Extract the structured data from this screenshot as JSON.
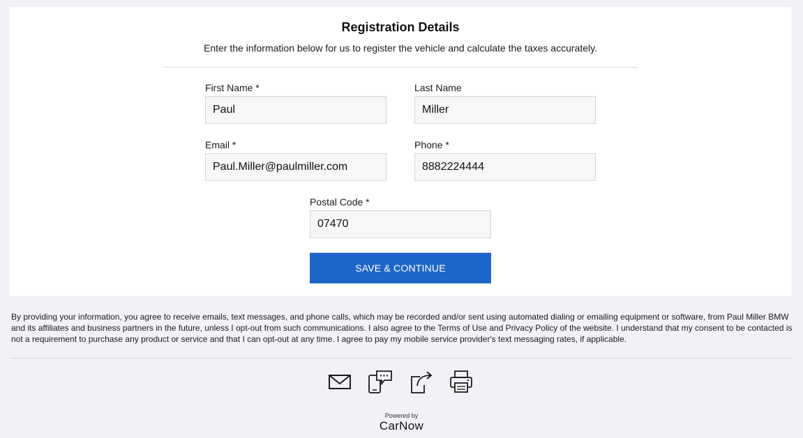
{
  "form": {
    "title": "Registration Details",
    "subtitle": "Enter the information below for us to register the vehicle and calculate the taxes accurately.",
    "first_name": {
      "label": "First Name *",
      "value": "Paul"
    },
    "last_name": {
      "label": "Last Name",
      "value": "Miller"
    },
    "email": {
      "label": "Email *",
      "value": "Paul.Miller@paulmiller.com"
    },
    "phone": {
      "label": "Phone *",
      "value": "8882224444"
    },
    "postal_code": {
      "label": "Postal Code *",
      "value": "07470"
    },
    "save_label": "SAVE & CONTINUE"
  },
  "disclaimer": "By providing your information, you agree to receive emails, text messages, and phone calls, which may be recorded and/or sent using automated dialing or emailing equipment or software, from Paul Miller BMW and its affiliates and business partners in the future, unless I opt-out from such communications. I also agree to the Terms of Use and Privacy Policy of the website. I understand that my consent to be contacted is not a requirement to purchase any product or service and that I can opt-out at any time. I agree to pay my mobile service provider's text messaging rates, if applicable.",
  "footer": {
    "icons": [
      "email-icon",
      "text-message-icon",
      "share-icon",
      "print-icon"
    ],
    "powered_by": "Powered by",
    "brand": "CarNow"
  },
  "colors": {
    "accent": "#1e67c8",
    "background": "#f1f2f6",
    "card": "#ffffff",
    "input_bg": "#f7f7f7"
  }
}
